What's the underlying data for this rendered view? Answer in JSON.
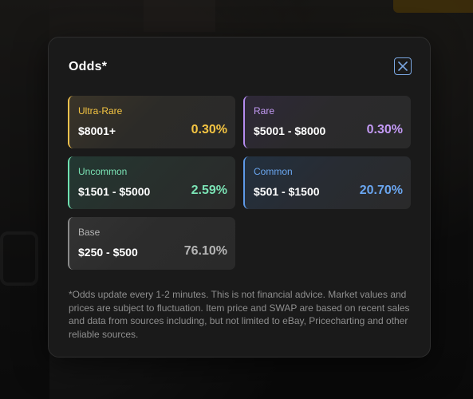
{
  "modal": {
    "title": "Odds*",
    "close_icon": "close-icon",
    "tiers": [
      {
        "name": "Ultra-Rare",
        "range": "$8001+",
        "odds": "0.30%",
        "color": "#f5c542"
      },
      {
        "name": "Rare",
        "range": "$5001 - $8000",
        "odds": "0.30%",
        "color": "#c39af5"
      },
      {
        "name": "Uncommon",
        "range": "$1501 - $5000",
        "odds": "2.59%",
        "color": "#7be3b5"
      },
      {
        "name": "Common",
        "range": "$501 - $1500",
        "odds": "20.70%",
        "color": "#6aa6f0"
      },
      {
        "name": "Base",
        "range": "$250 - $500",
        "odds": "76.10%",
        "color": "#b5b5b5"
      }
    ],
    "disclaimer": "*Odds update every 1-2 minutes. This is not financial advice. Market values and prices are subject to fluctuation. Item price and SWAP are based on recent sales and data from sources including, but not limited to eBay, Pricecharting and other reliable sources."
  }
}
